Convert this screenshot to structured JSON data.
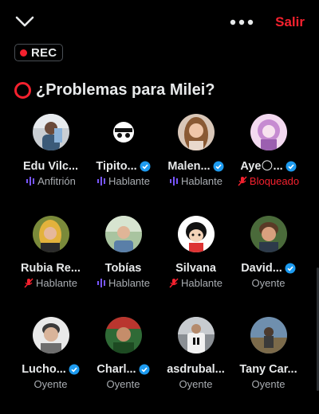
{
  "header": {
    "close_icon": "chevron-down-icon",
    "more_icon": "more-dots-icon",
    "exit_label": "Salir"
  },
  "recording": {
    "label": "REC"
  },
  "space": {
    "title": "¿Problemas para Milei?"
  },
  "colors": {
    "accent_red": "#f4212e",
    "verified_blue": "#1d9bf0",
    "speaking_purple": "#7856ff",
    "muted_text": "#a9adb2"
  },
  "participants": [
    {
      "name": "Edu Vilc...",
      "verified": false,
      "role": "Anfitrión",
      "role_icon": "speaking-bars-icon",
      "blocked": false
    },
    {
      "name": "Tipito...",
      "verified": true,
      "role": "Hablante",
      "role_icon": "speaking-bars-icon",
      "blocked": false
    },
    {
      "name": "Malen...",
      "verified": true,
      "role": "Hablante",
      "role_icon": "speaking-bars-icon",
      "blocked": false
    },
    {
      "name": "Aye🌕...",
      "verified": true,
      "role": "Bloqueado",
      "role_icon": "mic-off-icon",
      "blocked": true
    },
    {
      "name": "Rubia Re...",
      "verified": false,
      "role": "Hablante",
      "role_icon": "mic-off-icon",
      "blocked": false
    },
    {
      "name": "Tobías",
      "verified": false,
      "role": "Hablante",
      "role_icon": "speaking-bars-icon",
      "blocked": false
    },
    {
      "name": "Silvana",
      "verified": false,
      "role": "Hablante",
      "role_icon": "mic-off-icon",
      "blocked": false
    },
    {
      "name": "David...",
      "verified": true,
      "role": "Oyente",
      "role_icon": "",
      "blocked": false
    },
    {
      "name": "Lucho...",
      "verified": true,
      "role": "Oyente",
      "role_icon": "",
      "blocked": false
    },
    {
      "name": "Charl...",
      "verified": true,
      "role": "Oyente",
      "role_icon": "",
      "blocked": false
    },
    {
      "name": "asdrubal...",
      "verified": false,
      "role": "Oyente",
      "role_icon": "",
      "blocked": false
    },
    {
      "name": "Tany Car...",
      "verified": false,
      "role": "Oyente",
      "role_icon": "",
      "blocked": false
    }
  ]
}
